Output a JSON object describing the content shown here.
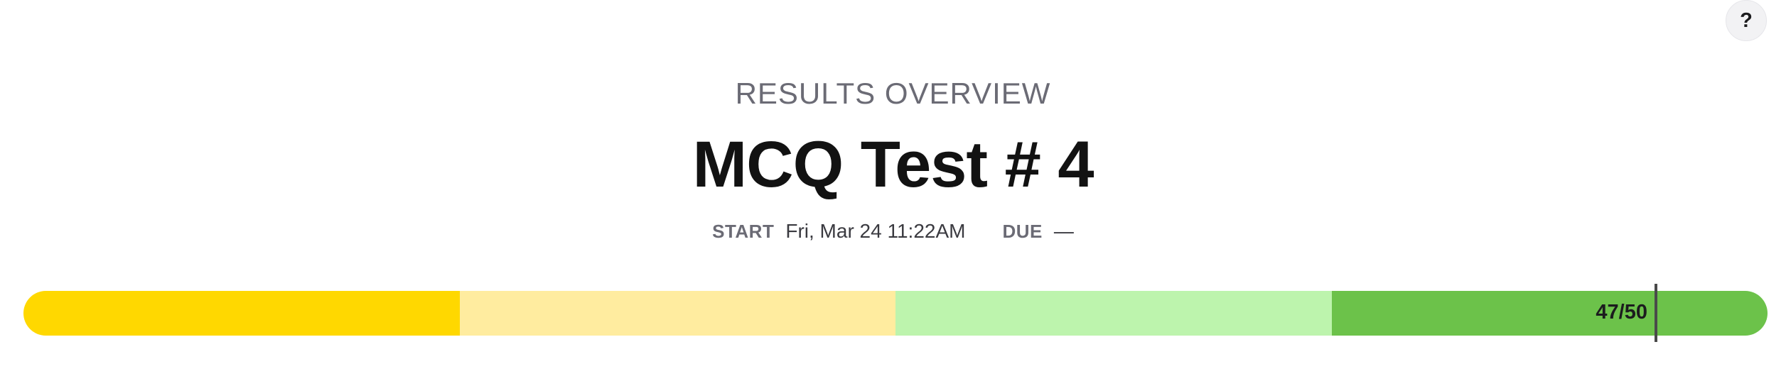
{
  "help_button": {
    "label": "?"
  },
  "header": {
    "subtitle": "RESULTS OVERVIEW",
    "title": "MCQ Test # 4"
  },
  "meta": {
    "start_label": "START",
    "start_value": "Fri, Mar 24 11:22AM",
    "due_label": "DUE",
    "due_value": "—"
  },
  "score_bar": {
    "score_label": "47/50",
    "score": 47,
    "max": 50,
    "segments": [
      {
        "color": "#ffd800"
      },
      {
        "color": "#ffec9f"
      },
      {
        "color": "#bdf4ad"
      },
      {
        "color": "#6cc24a"
      }
    ]
  }
}
